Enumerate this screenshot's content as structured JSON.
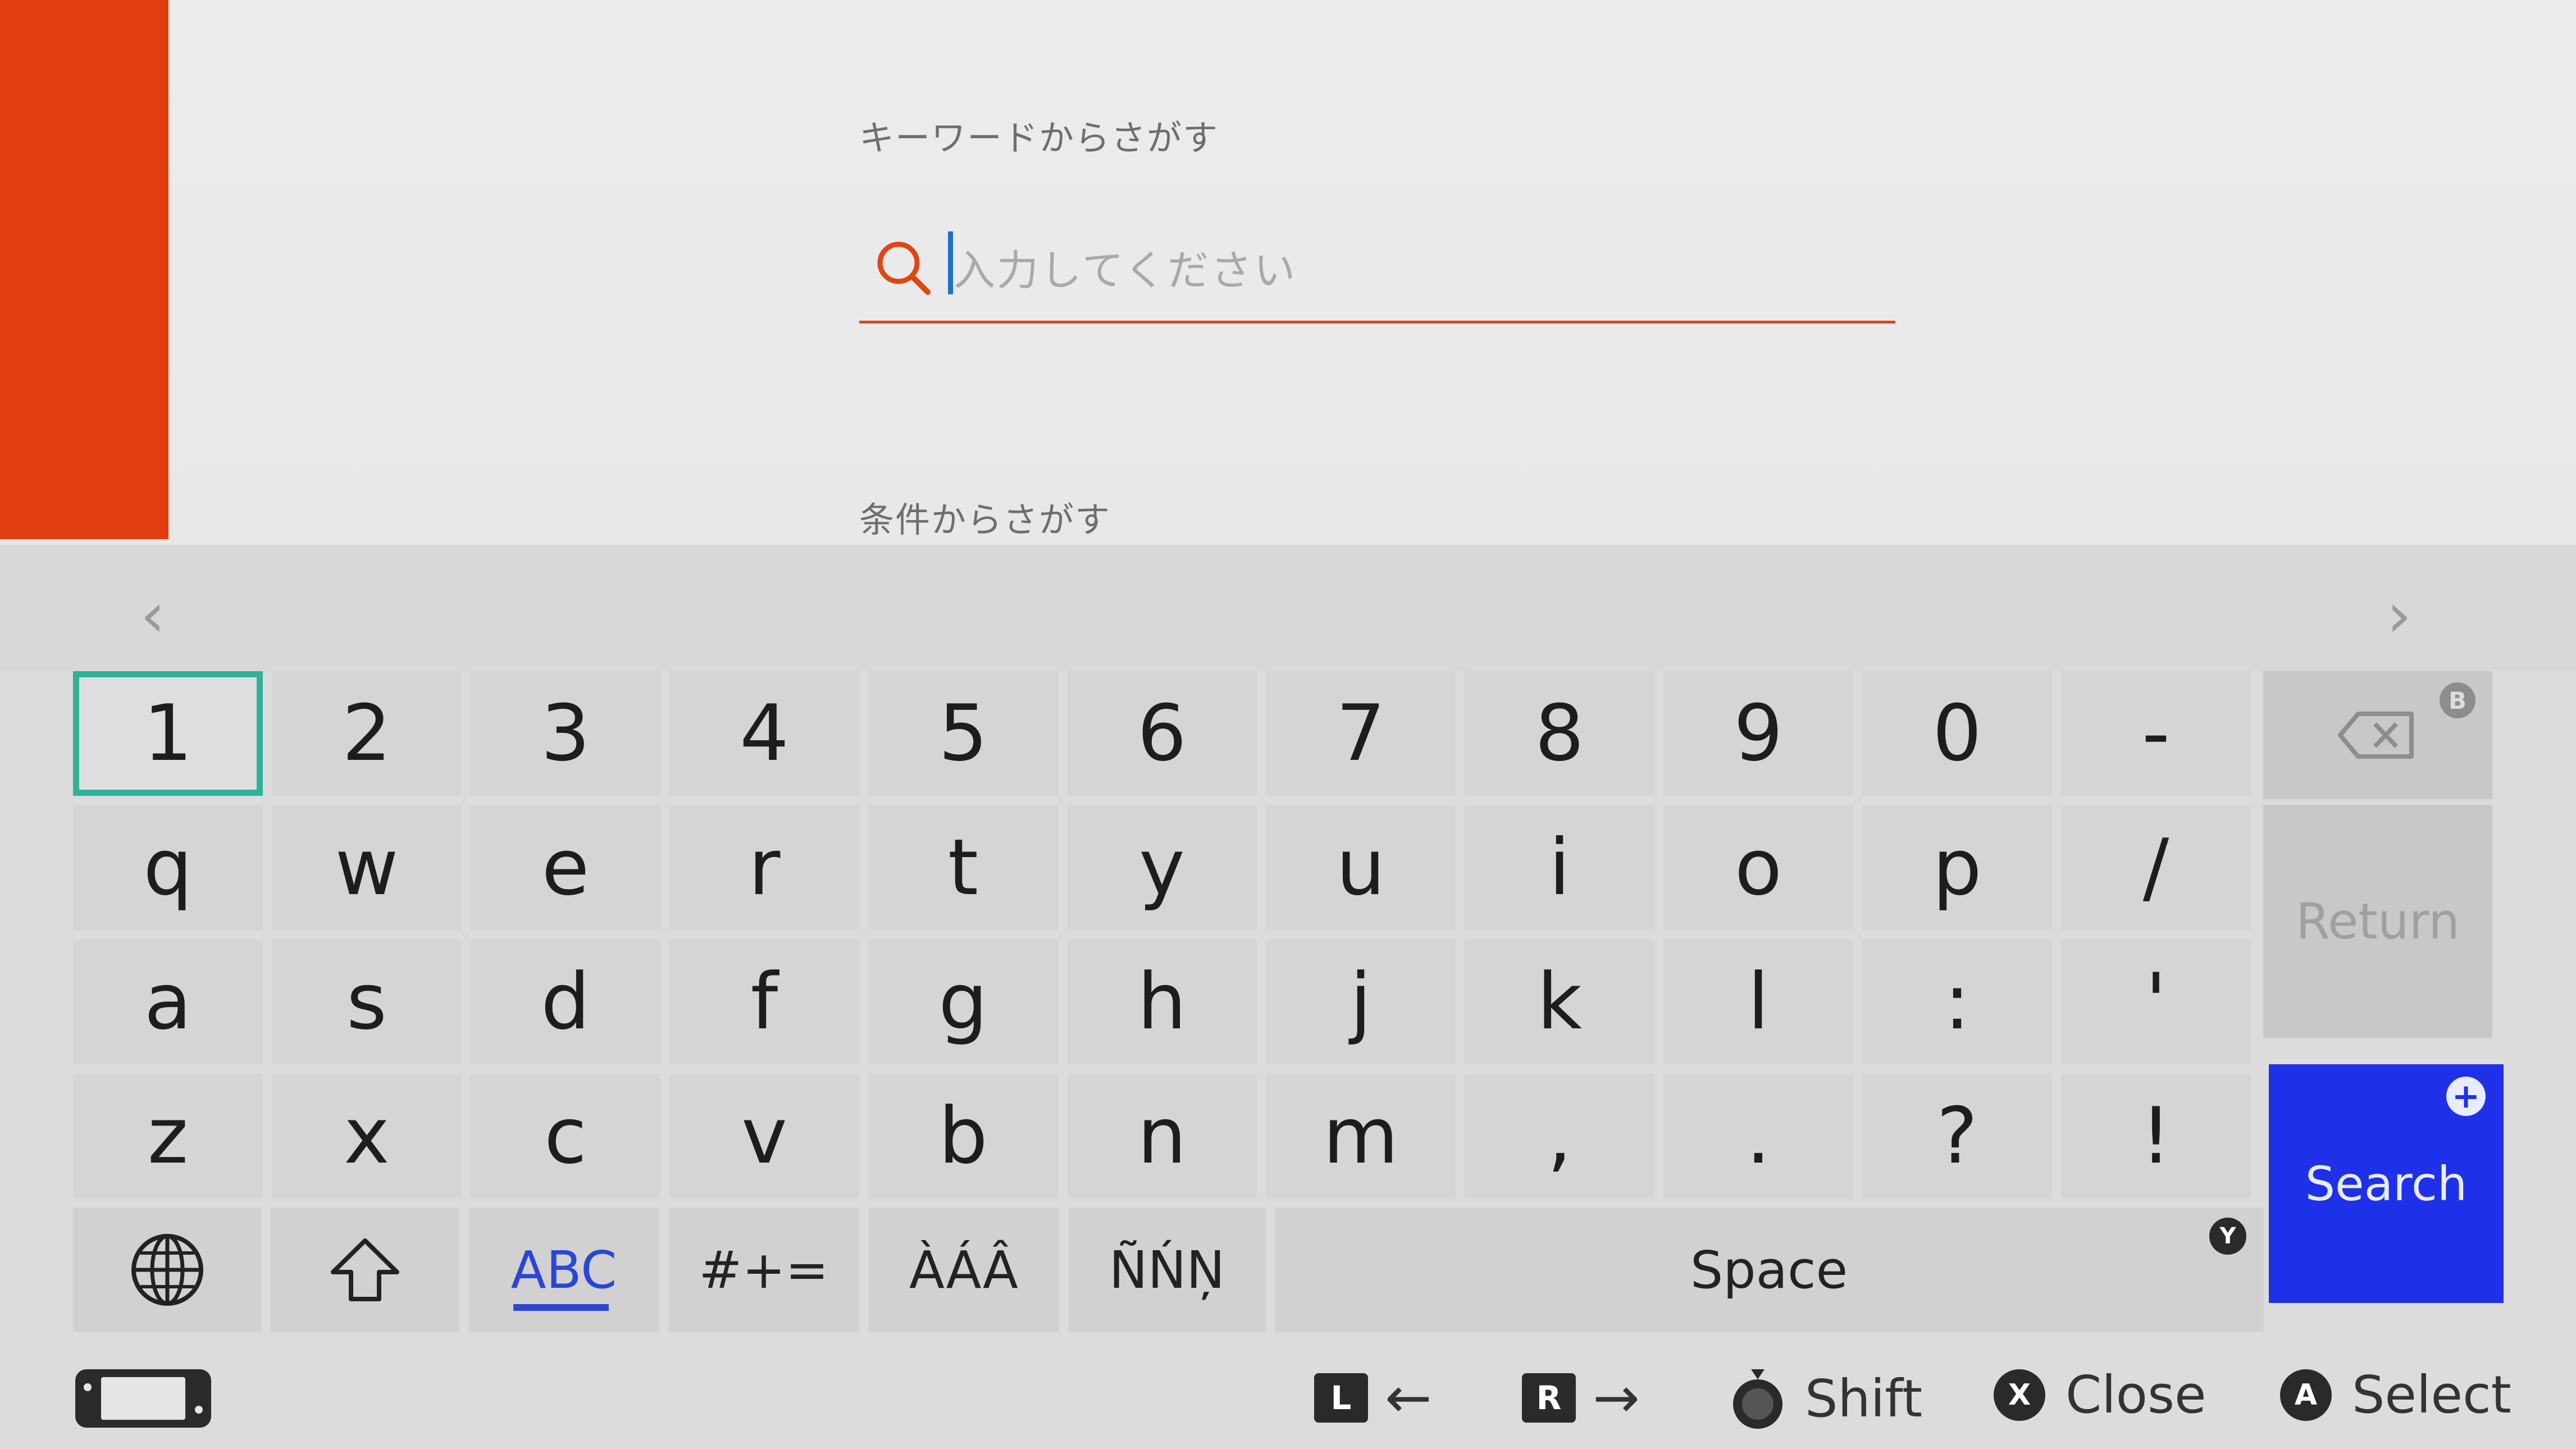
{
  "search_page": {
    "keyword_label": "キーワードからさがす",
    "search_placeholder": "入力してください",
    "conditions_label": "条件からさがす"
  },
  "keyboard": {
    "rows": [
      [
        "1",
        "2",
        "3",
        "4",
        "5",
        "6",
        "7",
        "8",
        "9",
        "0",
        "-"
      ],
      [
        "q",
        "w",
        "e",
        "r",
        "t",
        "y",
        "u",
        "i",
        "o",
        "p",
        "/"
      ],
      [
        "a",
        "s",
        "d",
        "f",
        "g",
        "h",
        "j",
        "k",
        "l",
        ":",
        "'"
      ],
      [
        "z",
        "x",
        "c",
        "v",
        "b",
        "n",
        "m",
        ",",
        ".",
        "?",
        "!"
      ]
    ],
    "selected_key": "1",
    "backspace_badge": "B",
    "return_label": "Return",
    "search_label": "Search",
    "search_badge": "+",
    "abc_label": "ABC",
    "symbols_label": "#+=",
    "accents_a_label": "ÀÁÂ",
    "accents_n_label": "ÑŃŅ",
    "space_label": "Space",
    "space_badge": "Y",
    "nav_left": "‹",
    "nav_right": "›"
  },
  "footer": {
    "l_button": "L",
    "l_arrow": "←",
    "r_button": "R",
    "r_arrow": "→",
    "shift_label": "Shift",
    "close_button": "X",
    "close_label": "Close",
    "select_button": "A",
    "select_label": "Select"
  },
  "colors": {
    "accent_orange": "#e03d10",
    "search_key_blue": "#1e31e8",
    "selection_green": "#2eb39a",
    "abc_blue": "#2b46d6"
  }
}
